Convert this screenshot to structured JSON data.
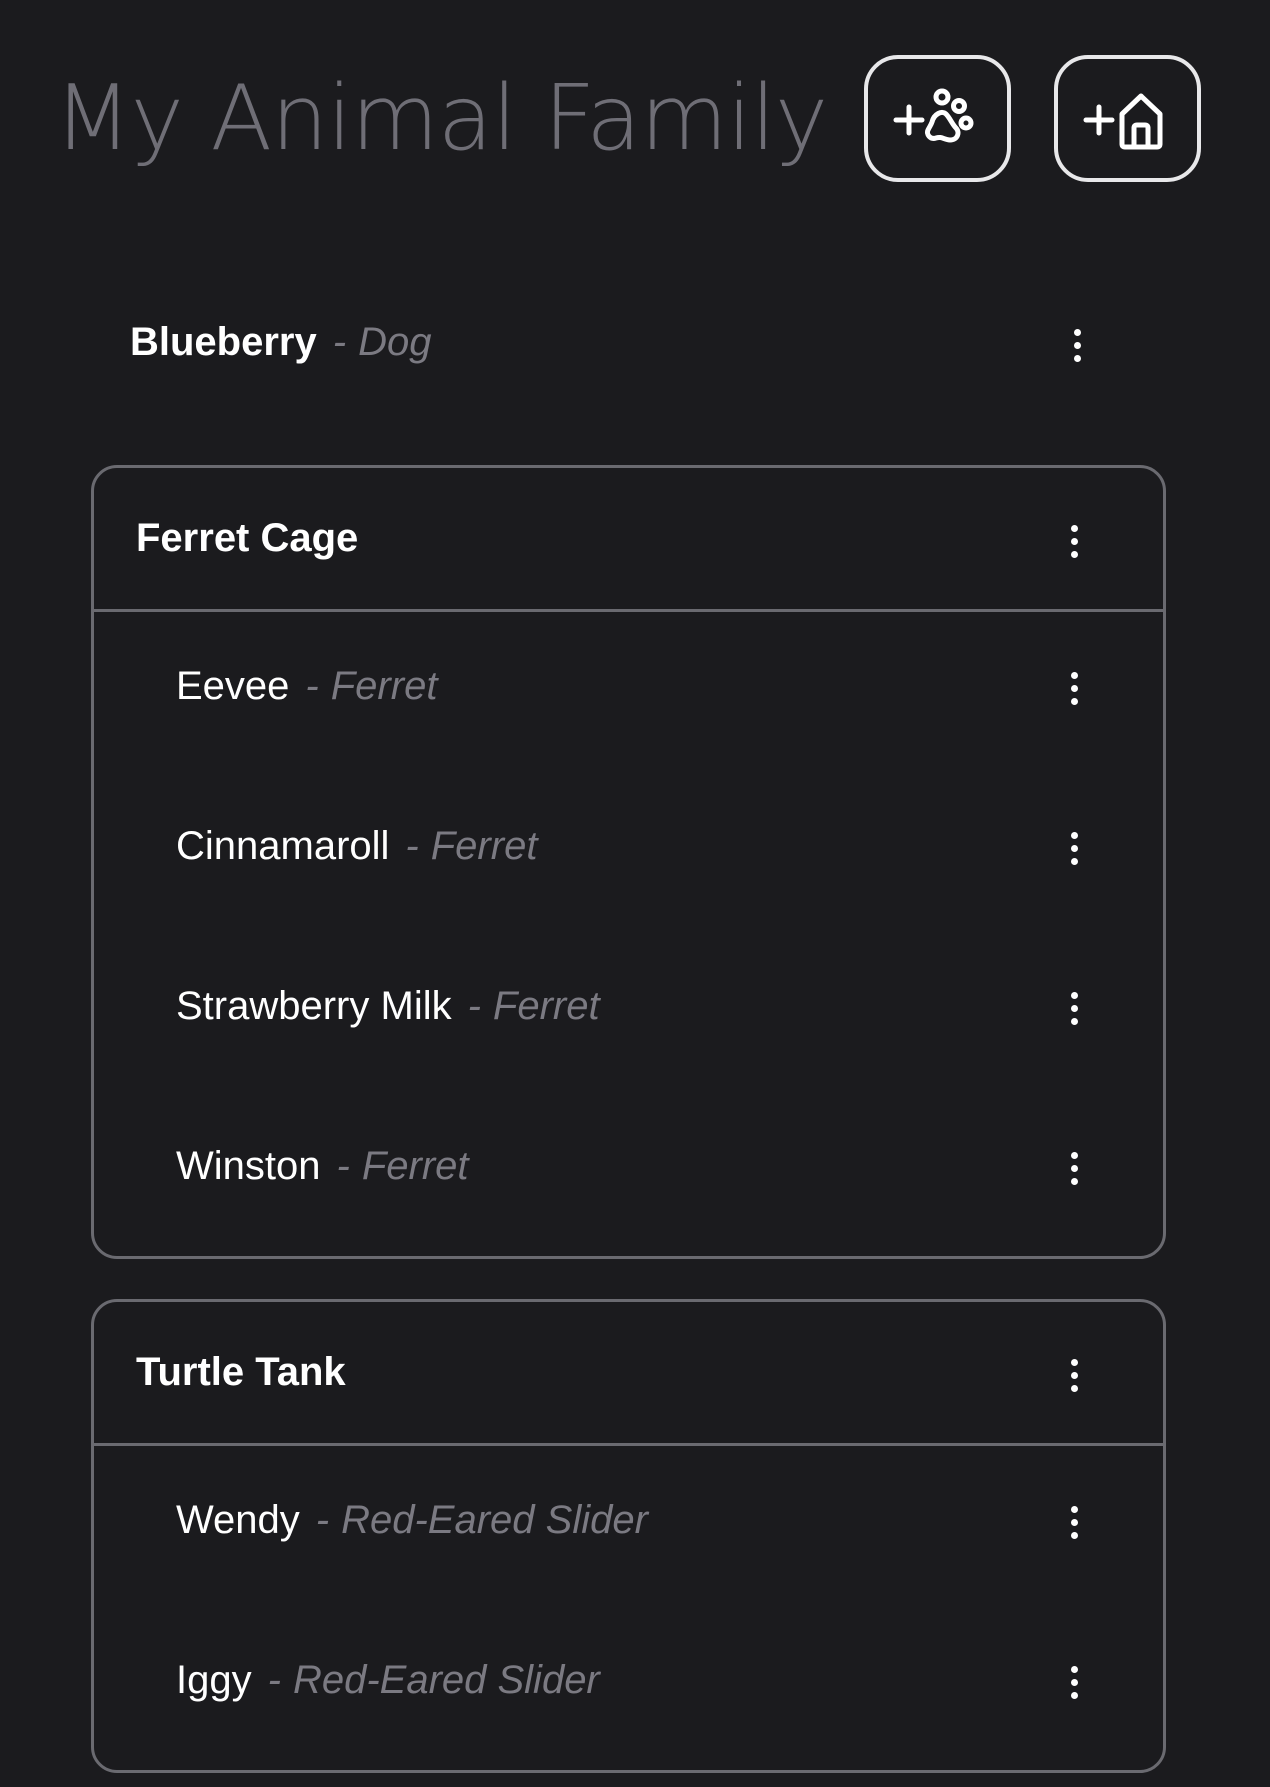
{
  "header": {
    "title": "My Animal Family",
    "add_pet_icon": "plus-paw-icon",
    "add_enclosure_icon": "plus-home-icon"
  },
  "pets": [
    {
      "name": "Blueberry",
      "separator": "-",
      "species": "Dog"
    }
  ],
  "enclosures": [
    {
      "name": "Ferret Cage",
      "pets": [
        {
          "name": "Eevee",
          "separator": "-",
          "species": "Ferret"
        },
        {
          "name": "Cinnamaroll",
          "separator": "-",
          "species": "Ferret"
        },
        {
          "name": "Strawberry Milk",
          "separator": "-",
          "species": "Ferret"
        },
        {
          "name": "Winston",
          "separator": "-",
          "species": "Ferret"
        }
      ]
    },
    {
      "name": "Turtle Tank",
      "pets": [
        {
          "name": "Wendy",
          "separator": "-",
          "species": "Red-Eared Slider"
        },
        {
          "name": "Iggy",
          "separator": "-",
          "species": "Red-Eared Slider"
        }
      ]
    }
  ],
  "colors": {
    "background": "#1b1b1e",
    "title": "#6f6e76",
    "border": "#6a6a70",
    "species_text": "#7b7a82",
    "text": "#ffffff"
  }
}
